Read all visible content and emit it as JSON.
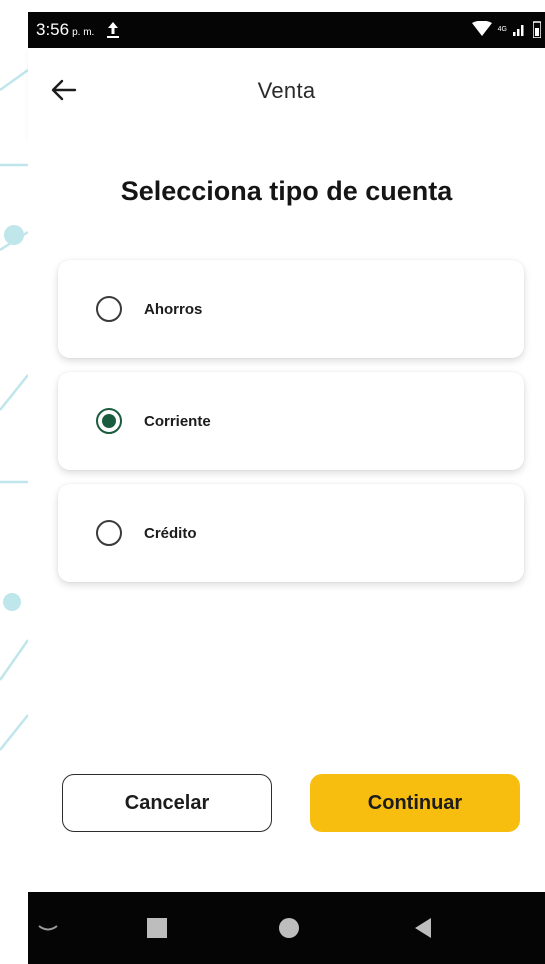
{
  "status_bar": {
    "time": "3:56",
    "ampm": "p. m.",
    "network": "4G"
  },
  "header": {
    "title": "Venta"
  },
  "main": {
    "section_title": "Selecciona tipo de cuenta",
    "options": [
      {
        "label": "Ahorros",
        "selected": false
      },
      {
        "label": "Corriente",
        "selected": true
      },
      {
        "label": "Crédito",
        "selected": false
      }
    ]
  },
  "actions": {
    "cancel_label": "Cancelar",
    "continue_label": "Continuar"
  },
  "icons": {
    "back": "back-arrow-icon",
    "upload": "upload-icon",
    "wifi": "wifi-icon",
    "signal": "signal-icon",
    "battery": "battery-icon",
    "nav_down": "chevron-down-icon",
    "nav_recents": "square-icon",
    "nav_home": "circle-icon",
    "nav_back": "triangle-back-icon"
  },
  "colors": {
    "accent": "#f7be0f",
    "radio_selected": "#1a5c3e",
    "decoration": "#bfe6ea",
    "bars": "#050505"
  }
}
